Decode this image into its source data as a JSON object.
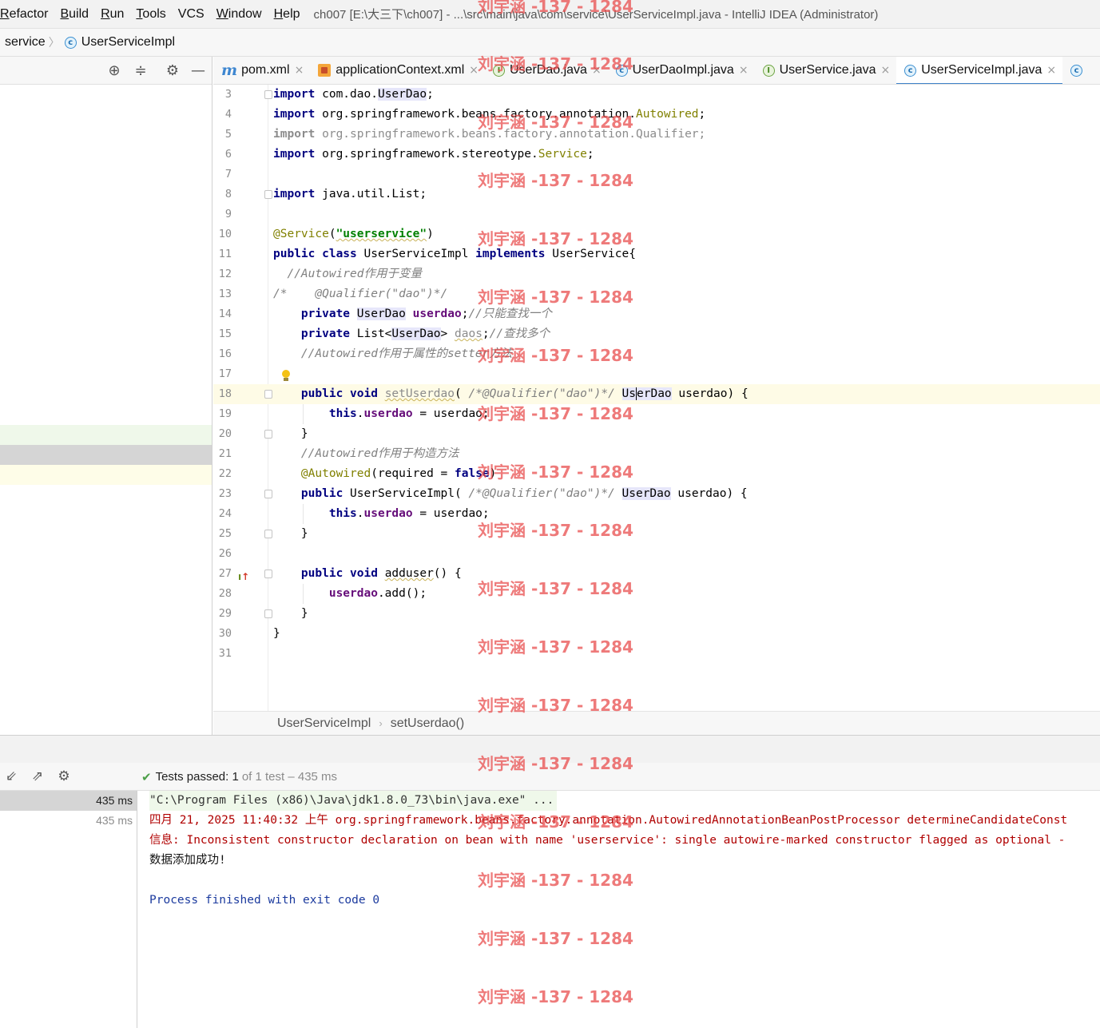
{
  "menu": {
    "items": [
      "Refactor",
      "Build",
      "Run",
      "Tools",
      "VCS",
      "Window",
      "Help"
    ],
    "mnemonics": [
      "R",
      "B",
      "R",
      "T",
      "",
      "W",
      "H"
    ],
    "window_title": "ch007 [E:\\大三下\\ch007] - ...\\src\\main\\java\\com\\service\\UserServiceImpl.java - IntelliJ IDEA (Administrator)"
  },
  "breadcrumb": {
    "segment1": "service",
    "segment2": "UserServiceImpl"
  },
  "tabs": [
    {
      "label": "pom.xml",
      "icon": "maven-icon"
    },
    {
      "label": "applicationContext.xml",
      "icon": "xml-config-icon"
    },
    {
      "label": "UserDao.java",
      "icon": "interface-icon"
    },
    {
      "label": "UserDaoImpl.java",
      "icon": "class-icon"
    },
    {
      "label": "UserService.java",
      "icon": "interface-icon"
    },
    {
      "label": "UserServiceImpl.java",
      "icon": "class-icon",
      "active": true
    }
  ],
  "editor": {
    "line_numbers": [
      "3",
      "4",
      "5",
      "6",
      "7",
      "8",
      "9",
      "10",
      "11",
      "12",
      "13",
      "14",
      "15",
      "16",
      "17",
      "18",
      "19",
      "20",
      "21",
      "22",
      "23",
      "24",
      "25",
      "26",
      "27",
      "28",
      "29",
      "30",
      "31"
    ],
    "comments": {
      "l12": "//Autowired作用于变量",
      "l13": "/*    @Qualifier(\"dao\")*/",
      "l14": "//只能查找一个",
      "l15": "//查找多个",
      "l16": "//Autowired作用于属性的setter方法",
      "l21": "//Autowired作用于构造方法",
      "qualifier_inline": "/*@Qualifier(\"dao\")*/"
    },
    "status_crumbs": [
      "UserServiceImpl",
      "setUserdao()"
    ]
  },
  "run": {
    "tests_passed_label": "Tests passed:",
    "tests_passed_count": "1",
    "tests_detail": "of 1 test – 435 ms",
    "times": [
      "435 ms",
      "435 ms"
    ],
    "console": [
      "\"C:\\Program Files (x86)\\Java\\jdk1.8.0_73\\bin\\java.exe\" ...",
      "四月 21, 2025 11:40:32 上午 org.springframework.beans.factory.annotation.AutowiredAnnotationBeanPostProcessor determineCandidateConst",
      "信息: Inconsistent constructor declaration on bean with name 'userservice': single autowire-marked constructor flagged as optional -",
      "数据添加成功!",
      "",
      "Process finished with exit code 0"
    ]
  },
  "watermark": "刘宇涵 -137 - 1284"
}
